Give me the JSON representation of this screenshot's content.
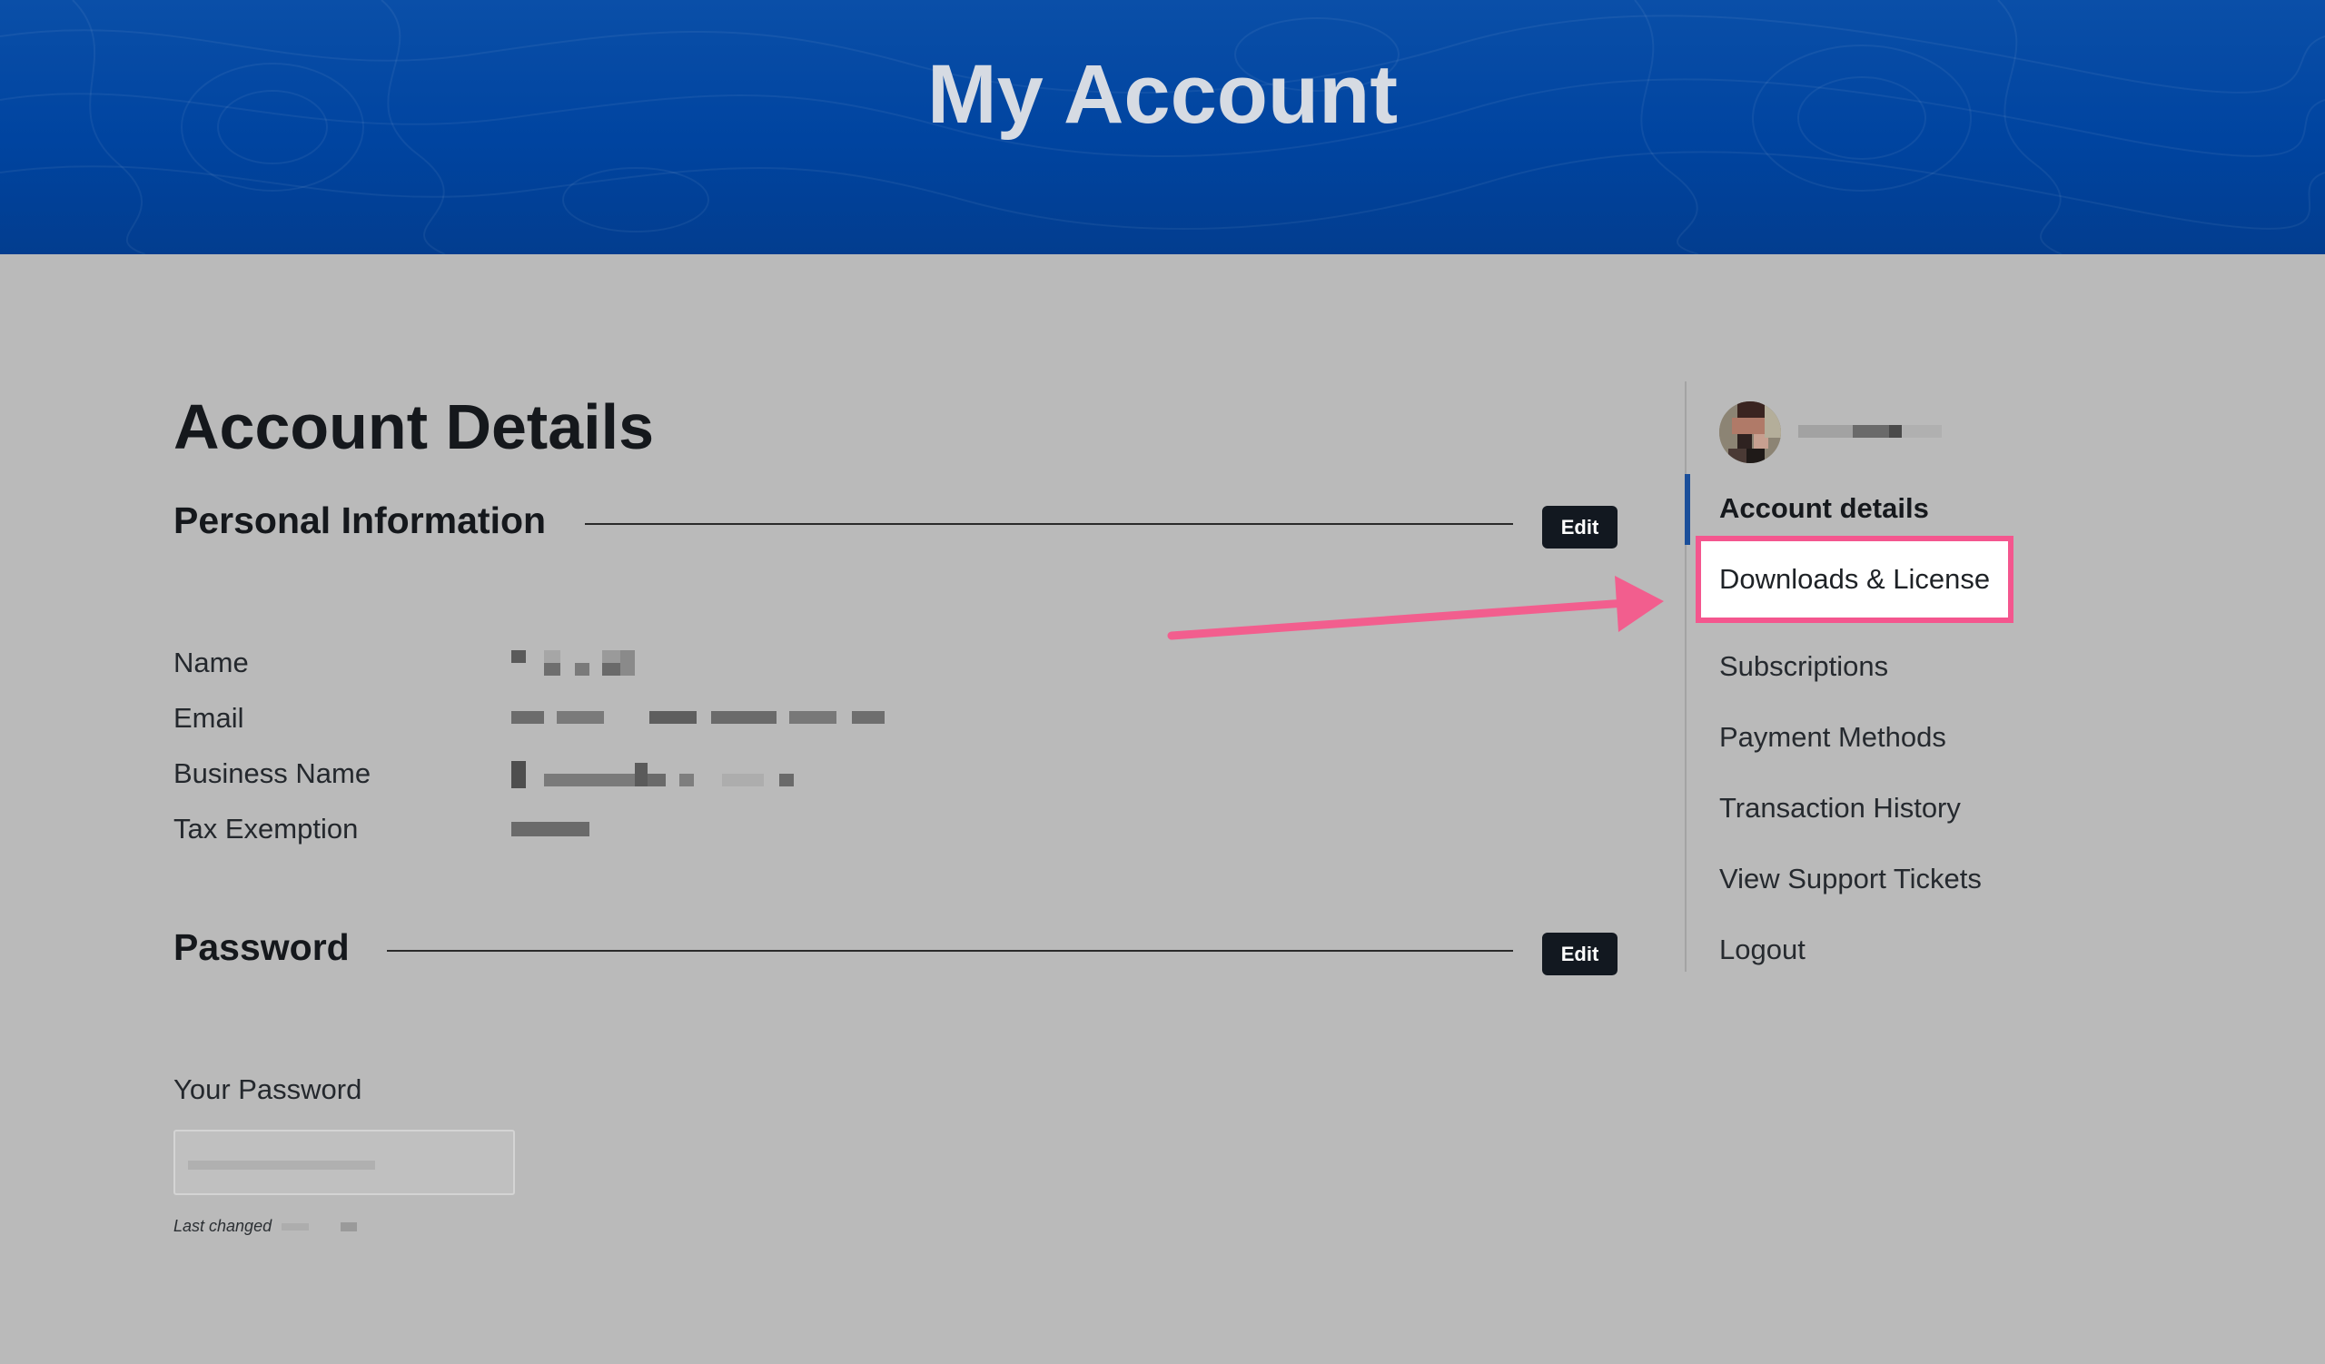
{
  "header": {
    "title": "My Account"
  },
  "main": {
    "title": "Account Details",
    "personal": {
      "heading": "Personal Information",
      "edit_label": "Edit",
      "rows": [
        {
          "label": "Name"
        },
        {
          "label": "Email"
        },
        {
          "label": "Business Name"
        },
        {
          "label": "Tax Exemption"
        }
      ]
    },
    "password": {
      "heading": "Password",
      "edit_label": "Edit",
      "field_label": "Your Password",
      "last_changed": "Last changed"
    }
  },
  "sidebar": {
    "items": [
      {
        "label": "Account details",
        "active": true
      },
      {
        "label": "Downloads & License",
        "highlighted": true
      },
      {
        "label": "Subscriptions"
      },
      {
        "label": "Payment Methods"
      },
      {
        "label": "Transaction History"
      },
      {
        "label": "View Support Tickets"
      },
      {
        "label": "Logout"
      }
    ]
  },
  "annotation": {
    "highlight_color": "#f4568e",
    "arrow_color": "#f25e8e"
  },
  "colors": {
    "header_blue": "#0044a0",
    "button_dark": "#121820",
    "active_bar": "#1b4f9a"
  },
  "icons": {
    "avatar": "user-avatar-icon"
  }
}
